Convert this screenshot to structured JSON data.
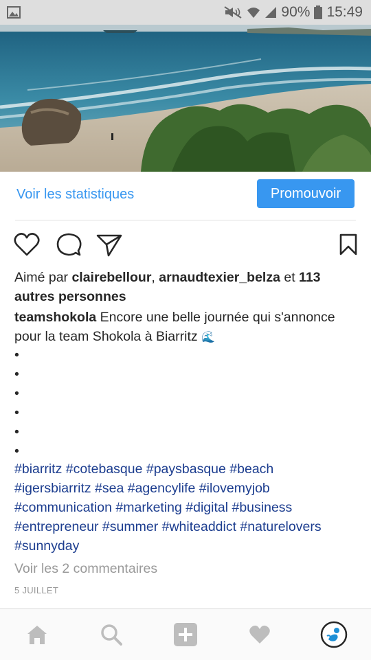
{
  "status_bar": {
    "battery": "90%",
    "time": "15:49"
  },
  "post": {
    "stats_link": "Voir les statistiques",
    "promote_button": "Promouvoir",
    "likes": {
      "prefix": "Aimé par",
      "user1": "clairebellour",
      "separator": ",",
      "user2": "arnaudtexier_belza",
      "connector": "et",
      "others_line1": "113",
      "others_line2": "autres personnes"
    },
    "caption": {
      "username": "teamshokola",
      "text": "Encore une belle journée qui s'annonce pour la team Shokola à Biarritz",
      "emoji": "🌊"
    },
    "dots": [
      "•",
      "•",
      "•",
      "•",
      "•",
      "•"
    ],
    "hashtags": [
      "#biarritz #cotebasque #paysbasque #beach",
      "#igersbiarritz #sea #agencylife #ilovemyjob",
      "#communication #marketing #digital #business",
      "#entrepreneur #summer #whiteaddict #naturelovers",
      "#sunnyday"
    ],
    "comments_link": "Voir les 2 commentaires",
    "date": "5 JUILLET"
  },
  "icons": {
    "gallery": "image-icon",
    "mute": "mute-icon",
    "wifi": "wifi-icon",
    "signal": "signal-icon",
    "battery": "battery-icon",
    "like": "heart-icon",
    "comment": "comment-icon",
    "share": "paper-plane-icon",
    "save": "bookmark-icon",
    "home": "home-icon",
    "search": "search-icon",
    "add": "add-post-icon",
    "activity": "heart-nav-icon",
    "profile": "profile-avatar-icon"
  },
  "colors": {
    "accent": "#3897f0",
    "hashtag": "#1c3d8f",
    "muted": "#999999",
    "text": "#262626"
  }
}
